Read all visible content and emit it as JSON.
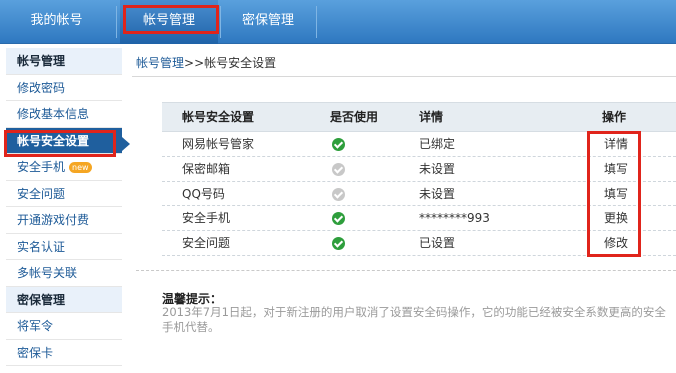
{
  "topnav": {
    "tabs": [
      {
        "label": "我的帐号"
      },
      {
        "label": "帐号管理"
      },
      {
        "label": "密保管理"
      }
    ]
  },
  "sidebar": {
    "items": [
      {
        "label": "帐号管理",
        "type": "group"
      },
      {
        "label": "修改密码"
      },
      {
        "label": "修改基本信息"
      },
      {
        "label": "帐号安全设置",
        "active": true
      },
      {
        "label": "安全手机",
        "badge": "new"
      },
      {
        "label": "安全问题"
      },
      {
        "label": "开通游戏付费"
      },
      {
        "label": "实名认证"
      },
      {
        "label": "多帐号关联"
      },
      {
        "label": "密保管理",
        "type": "group"
      },
      {
        "label": "将军令"
      },
      {
        "label": "密保卡"
      }
    ]
  },
  "breadcrumb": {
    "parent": "帐号管理",
    "separator": ">>",
    "current": "帐号安全设置"
  },
  "table": {
    "headers": [
      "帐号安全设置",
      "是否使用",
      "详情",
      "操作"
    ],
    "rows": [
      {
        "name": "网易帐号管家",
        "in_use": true,
        "detail": "已绑定",
        "action": "详情"
      },
      {
        "name": "保密邮箱",
        "in_use": false,
        "detail": "未设置",
        "action": "填写"
      },
      {
        "name": "QQ号码",
        "in_use": false,
        "detail": "未设置",
        "action": "填写"
      },
      {
        "name": "安全手机",
        "in_use": true,
        "detail": "********993",
        "action": "更换"
      },
      {
        "name": "安全问题",
        "in_use": true,
        "detail": "已设置",
        "action": "修改"
      }
    ]
  },
  "tips": {
    "title": "温馨提示：",
    "body": "2013年7月1日起，对于新注册的用户取消了设置安全码操作，它的功能已经被安全系数更高的安全手机代替。"
  },
  "colors": {
    "nav_blue": "#2f78c0",
    "active_side": "#1f5f9e",
    "highlight_red": "#e0241b",
    "check_green": "#2e9e3c",
    "check_gray": "#c8c8c8"
  }
}
